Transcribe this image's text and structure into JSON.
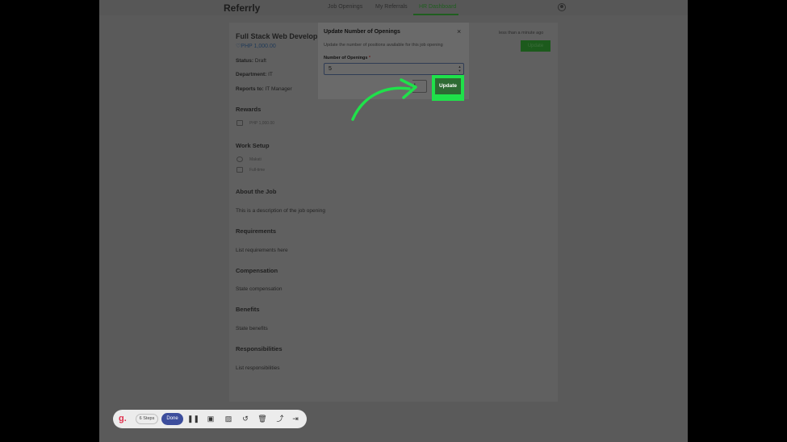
{
  "app": {
    "name": "Referrly",
    "nav": [
      "Job Openings",
      "My Referrals",
      "HR Dashboard"
    ],
    "active_nav": "HR Dashboard"
  },
  "job": {
    "title": "Full Stack Web Develop",
    "reward_header": "PHP 1,000.00",
    "posted": "less than a minute ago",
    "update_label": "Update",
    "status_label": "Status:",
    "status_value": "Draft",
    "department_label": "Department:",
    "department_value": "IT",
    "reports_label": "Reports to:",
    "reports_value": "IT Manager",
    "sections": {
      "rewards": "Rewards",
      "rewards_value": "PHP 1,000.00",
      "work_setup": "Work Setup",
      "work_location": "Makati",
      "work_type": "Full-time",
      "about": "About the Job",
      "about_text": "This is a description of the job opening",
      "requirements": "Requirements",
      "requirements_text": "List requirements here",
      "compensation": "Compensation",
      "compensation_text": "State compensation",
      "benefits": "Benefits",
      "benefits_text": "State benefits",
      "responsibilities": "Responsibilities",
      "responsibilities_text": "List responsibilities"
    }
  },
  "modal": {
    "title": "Update Number of Openings",
    "close": "×",
    "description": "Update the number of positions available for this job opening",
    "field_label": "Number of Openings",
    "required_mark": "*",
    "field_value": "5",
    "cancel_label": "l",
    "update_label": "Update"
  },
  "recorder": {
    "steps": "6 Steps",
    "done": "Done",
    "logo": "g."
  },
  "colors": {
    "accent_highlight": "#1fe14a",
    "brand_green": "#2e6b34",
    "done_blue": "#3c4d9c"
  },
  "icons": [
    "pause-icon",
    "stop-icon",
    "image-icon",
    "undo-icon",
    "trash-icon",
    "share-icon",
    "exit-icon"
  ]
}
